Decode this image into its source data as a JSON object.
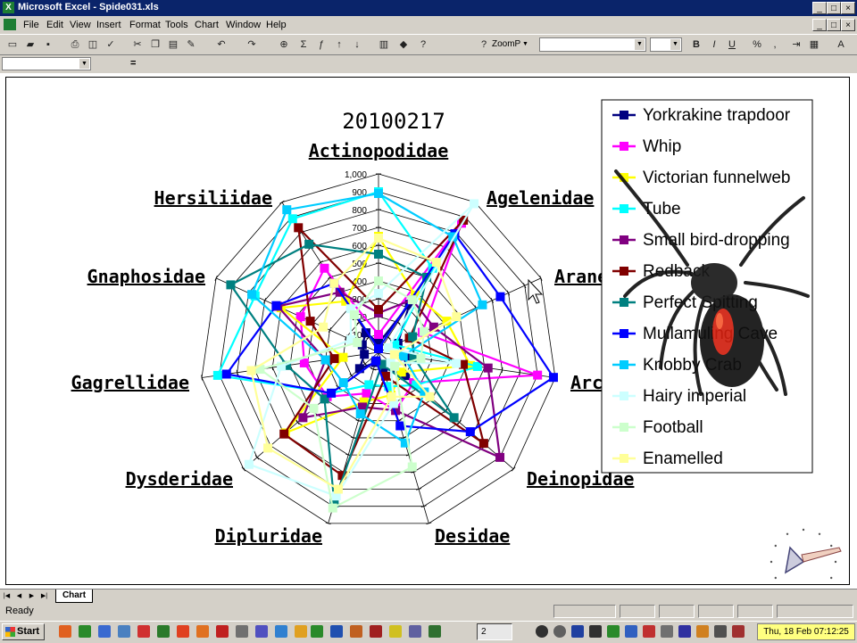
{
  "window": {
    "title": "Microsoft Excel - Spide031.xls",
    "app_icon": "excel-icon"
  },
  "menu": [
    "File",
    "Edit",
    "View",
    "Insert",
    "Format",
    "Tools",
    "Chart",
    "Window",
    "Help"
  ],
  "toolbar": {
    "zoom_label": "ZoomP",
    "font_name_value": ""
  },
  "formula_bar": {
    "name_box_value": "",
    "equals_label": "="
  },
  "colors": {
    "titlebar": "#0a246a",
    "clock_bg": "#ffff80"
  },
  "sheet": {
    "tabs": [
      "Chart"
    ]
  },
  "status": {
    "text": "Ready"
  },
  "taskbar": {
    "start_label": "Start",
    "clock": "Thu, 18 Feb 07:12:25",
    "excel_button_label": "2"
  },
  "chart_data": {
    "type": "radar",
    "title": "20100217",
    "categories": [
      "Actinopodidae",
      "Agelenidae",
      "Araneidae",
      "Archaeidae",
      "Deinopidae",
      "Desidae",
      "Dipluridae",
      "Dysderidae",
      "Gagrellidae",
      "Gnaphosidae",
      "Hersiliidae"
    ],
    "axis_ticks": [
      "1,000",
      "900",
      "800",
      "700",
      "600",
      "500",
      "400",
      "300",
      "200",
      "100",
      "0"
    ],
    "ylim": [
      0,
      1000
    ],
    "legend_position": "right",
    "series": [
      {
        "name": "Yorkrakine trapdoor",
        "color": "#000080",
        "values": [
          50,
          320,
          120,
          150,
          200,
          90,
          60,
          140,
          80,
          100,
          130
        ]
      },
      {
        "name": "Whip",
        "color": "#ff00ff",
        "values": [
          100,
          860,
          270,
          900,
          260,
          340,
          240,
          380,
          420,
          480,
          560
        ]
      },
      {
        "name": "Victorian funnelweb",
        "color": "#ffff00",
        "values": [
          650,
          380,
          420,
          520,
          170,
          250,
          290,
          690,
          200,
          600,
          340
        ]
      },
      {
        "name": "Tube",
        "color": "#00ffff",
        "values": [
          900,
          560,
          100,
          560,
          280,
          200,
          190,
          350,
          910,
          760,
          890
        ]
      },
      {
        "name": "Small bird-dropping",
        "color": "#800080",
        "values": [
          220,
          350,
          340,
          620,
          900,
          340,
          320,
          560,
          300,
          620,
          400
        ]
      },
      {
        "name": "Redback",
        "color": "#800000",
        "values": [
          240,
          880,
          190,
          480,
          780,
          140,
          720,
          700,
          250,
          420,
          830
        ]
      },
      {
        "name": "Perfect Spitting",
        "color": "#008080",
        "values": [
          550,
          500,
          210,
          200,
          560,
          70,
          880,
          400,
          520,
          910,
          720
        ]
      },
      {
        "name": "Mullamuling Cave",
        "color": "#0000ff",
        "values": [
          20,
          790,
          750,
          990,
          680,
          430,
          50,
          350,
          860,
          630,
          460
        ]
      },
      {
        "name": "Knobby Crab",
        "color": "#00ccff",
        "values": [
          890,
          770,
          640,
          140,
          340,
          530,
          360,
          260,
          300,
          780,
          950
        ]
      },
      {
        "name": "Hairy imperial",
        "color": "#ccffff",
        "values": [
          330,
          990,
          60,
          440,
          90,
          300,
          840,
          960,
          550,
          170,
          290
        ]
      },
      {
        "name": "Football",
        "color": "#ccffcc",
        "values": [
          400,
          350,
          280,
          240,
          120,
          670,
          910,
          480,
          670,
          130,
          250
        ]
      },
      {
        "name": "Enamelled",
        "color": "#ffff99",
        "values": [
          640,
          600,
          480,
          90,
          380,
          260,
          800,
          820,
          720,
          340,
          460
        ]
      }
    ]
  }
}
